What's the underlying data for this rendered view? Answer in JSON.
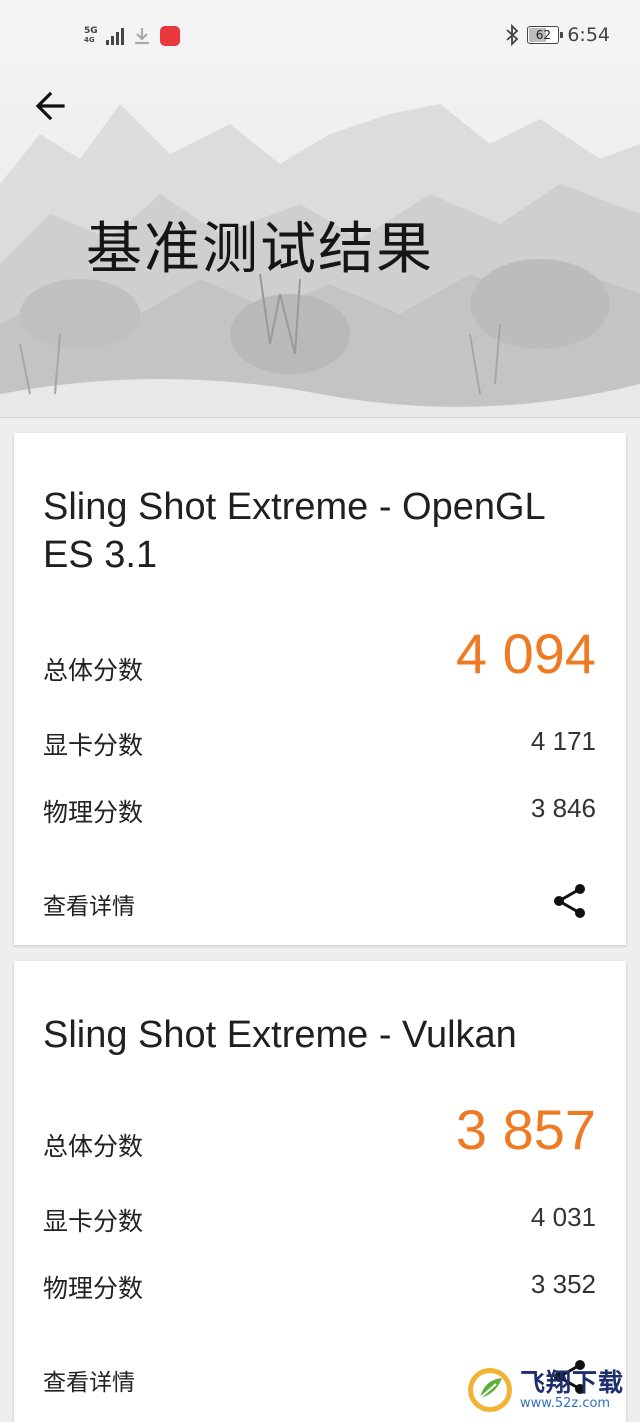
{
  "status_bar": {
    "network_type": "5G",
    "network_sub": "4G",
    "battery_level": 62,
    "battery_text": "62",
    "time": "6:54"
  },
  "header": {
    "title": "基准测试结果"
  },
  "results": [
    {
      "title": "Sling Shot Extreme - OpenGL ES 3.1",
      "overall_label": "总体分数",
      "overall_score": "4 094",
      "graphics_label": "显卡分数",
      "graphics_score": "4 171",
      "physics_label": "物理分数",
      "physics_score": "3 846",
      "details_label": "查看详情"
    },
    {
      "title": "Sling Shot Extreme - Vulkan",
      "overall_label": "总体分数",
      "overall_score": "3 857",
      "graphics_label": "显卡分数",
      "graphics_score": "4 031",
      "physics_label": "物理分数",
      "physics_score": "3 352",
      "details_label": "查看详情"
    }
  ],
  "watermark": {
    "name": "飞翔下载",
    "url": "www.52z.com"
  },
  "colors": {
    "accent_score": "#ee7b23",
    "card_bg": "#ffffff",
    "page_bg": "#eeeeee"
  },
  "icons": {
    "back": "arrow-left-icon",
    "share": "share-icon",
    "bluetooth": "bluetooth-icon",
    "download": "download-icon"
  }
}
